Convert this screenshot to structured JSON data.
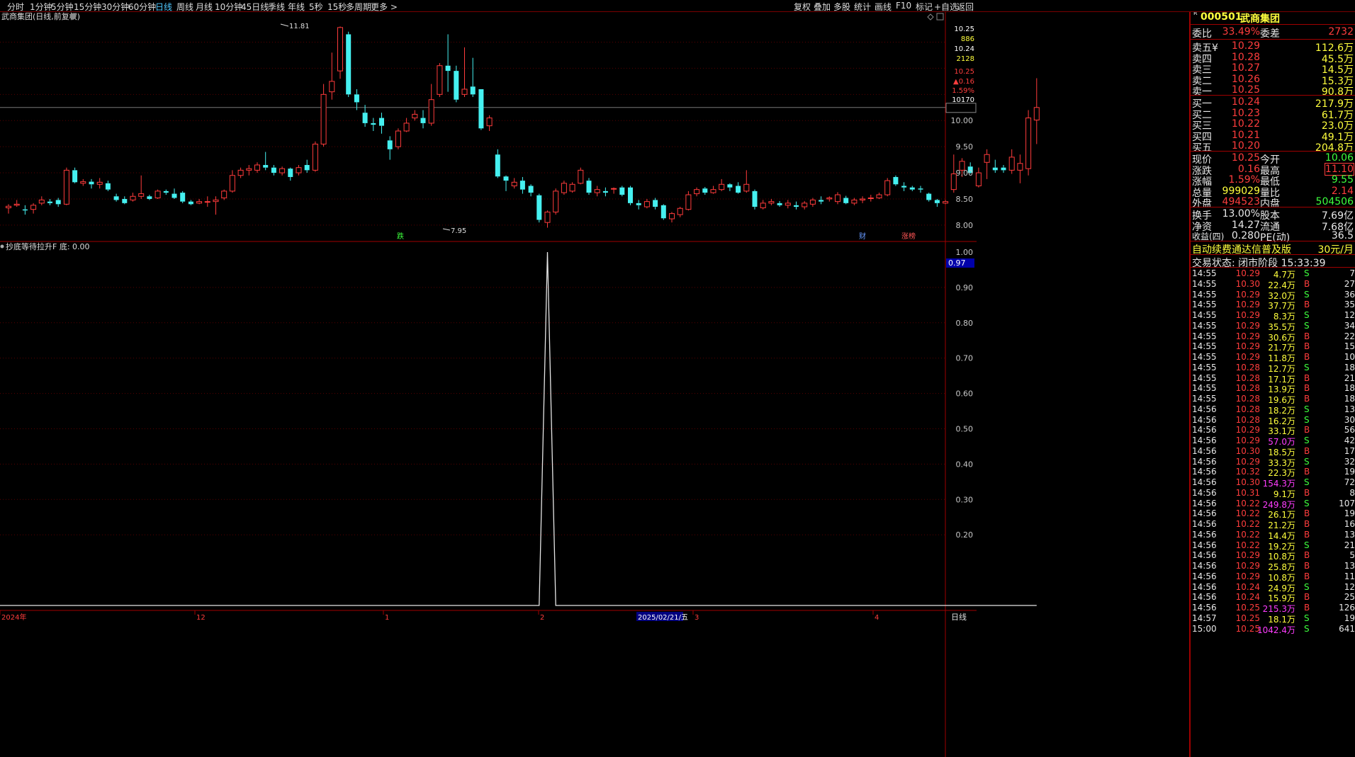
{
  "toolbar": {
    "left": [
      "分时",
      "1分钟",
      "5分钟",
      "15分钟",
      "30分钟",
      "60分钟",
      "日线",
      "周线",
      "月线",
      "10分钟",
      "45日线",
      "季线",
      "年线",
      "5秒",
      "15秒",
      "多周期",
      "更多 >"
    ],
    "active": "日线",
    "right": [
      "复权",
      "叠加",
      "多股",
      "统计",
      "画线",
      "F10",
      "标记",
      "+自选",
      "返回"
    ]
  },
  "chart": {
    "title": "武商集团(日线,前复权)",
    "indicator_title": "抄底等待拉升F 底: 0.00",
    "high_label": "11.81",
    "low_label": "7.95",
    "price_ticks": [
      "10.00",
      "9.50",
      "9.00",
      "8.50",
      "8.00"
    ],
    "osc_ticks": [
      "1.00",
      "0.90",
      "0.80",
      "0.70",
      "0.60",
      "0.50",
      "0.40",
      "0.30",
      "0.20"
    ],
    "osc_current": "0.97",
    "cursor_info": [
      "10.25",
      "886",
      "10.24",
      "2128",
      "10.25",
      "▲0.16",
      "1.59%",
      "10170"
    ],
    "date_labels": [
      "2024年",
      "12",
      "1",
      "2",
      "3",
      "4"
    ],
    "cursor_date": "2025/02/21/五",
    "period_label": "日线",
    "markers": [
      "跌",
      "财",
      "涨榜"
    ]
  },
  "chart_data": {
    "type": "candlestick",
    "candles": [
      [
        8.33,
        8.36,
        8.22,
        8.4
      ],
      [
        8.38,
        8.4,
        8.35,
        8.48
      ],
      [
        8.3,
        8.28,
        8.2,
        8.38
      ],
      [
        8.3,
        8.38,
        8.22,
        8.42
      ],
      [
        8.42,
        8.48,
        8.38,
        8.55
      ],
      [
        8.45,
        8.42,
        8.38,
        8.5
      ],
      [
        8.48,
        8.4,
        8.35,
        8.52
      ],
      [
        8.4,
        9.05,
        8.38,
        9.1
      ],
      [
        9.05,
        8.82,
        8.8,
        9.1
      ],
      [
        8.8,
        8.83,
        8.75,
        8.88
      ],
      [
        8.83,
        8.78,
        8.7,
        8.88
      ],
      [
        8.78,
        8.82,
        8.7,
        8.9
      ],
      [
        8.8,
        8.68,
        8.65,
        8.85
      ],
      [
        8.55,
        8.48,
        8.45,
        8.6
      ],
      [
        8.5,
        8.42,
        8.4,
        8.55
      ],
      [
        8.48,
        8.55,
        8.45,
        8.62
      ],
      [
        8.55,
        8.6,
        8.5,
        8.95
      ],
      [
        8.55,
        8.5,
        8.48,
        8.58
      ],
      [
        8.52,
        8.65,
        8.5,
        8.68
      ],
      [
        8.65,
        8.62,
        8.58,
        8.68
      ],
      [
        8.6,
        8.52,
        8.5,
        8.7
      ],
      [
        8.62,
        8.45,
        8.42,
        8.65
      ],
      [
        8.45,
        8.4,
        8.38,
        8.48
      ],
      [
        8.42,
        8.45,
        8.4,
        8.5
      ],
      [
        8.45,
        8.45,
        8.35,
        8.55
      ],
      [
        8.45,
        8.48,
        8.2,
        8.55
      ],
      [
        8.52,
        8.65,
        8.48,
        8.68
      ],
      [
        8.65,
        8.95,
        8.62,
        9.05
      ],
      [
        8.95,
        9.05,
        8.9,
        9.1
      ],
      [
        9.05,
        9.08,
        8.95,
        9.15
      ],
      [
        9.05,
        9.15,
        9.0,
        9.2
      ],
      [
        9.15,
        9.1,
        9.05,
        9.4
      ],
      [
        9.1,
        9.0,
        8.95,
        9.15
      ],
      [
        9.0,
        9.08,
        8.95,
        9.12
      ],
      [
        9.08,
        8.92,
        8.85,
        9.1
      ],
      [
        9.0,
        9.1,
        8.95,
        9.15
      ],
      [
        9.15,
        9.05,
        9.0,
        9.25
      ],
      [
        9.05,
        9.55,
        9.02,
        9.6
      ],
      [
        9.55,
        10.5,
        9.5,
        10.7
      ],
      [
        10.55,
        10.75,
        10.4,
        11.3
      ],
      [
        10.95,
        11.78,
        10.8,
        11.8
      ],
      [
        11.65,
        10.5,
        10.45,
        11.7
      ],
      [
        10.5,
        10.35,
        10.2,
        10.6
      ],
      [
        10.15,
        9.95,
        9.88,
        10.3
      ],
      [
        9.95,
        9.92,
        9.8,
        10.05
      ],
      [
        10.05,
        9.9,
        9.75,
        10.15
      ],
      [
        9.62,
        9.45,
        9.25,
        9.7
      ],
      [
        9.5,
        9.8,
        9.45,
        9.85
      ],
      [
        9.8,
        9.95,
        9.78,
        10.05
      ],
      [
        10.05,
        10.12,
        10.0,
        10.2
      ],
      [
        10.05,
        9.95,
        9.85,
        10.2
      ],
      [
        9.95,
        10.4,
        9.9,
        10.7
      ],
      [
        10.5,
        11.05,
        10.45,
        11.1
      ],
      [
        11.05,
        10.95,
        10.55,
        11.65
      ],
      [
        10.95,
        10.4,
        10.35,
        11.05
      ],
      [
        10.5,
        10.6,
        10.45,
        11.4
      ],
      [
        10.65,
        10.5,
        10.45,
        11.2
      ],
      [
        10.6,
        9.85,
        9.82,
        10.6
      ],
      [
        9.9,
        10.05,
        9.8,
        10.1
      ],
      [
        9.35,
        8.93,
        8.9,
        9.45
      ],
      [
        8.93,
        8.85,
        8.65,
        8.95
      ],
      [
        8.75,
        8.82,
        8.7,
        8.9
      ],
      [
        8.85,
        8.68,
        8.6,
        8.92
      ],
      [
        8.75,
        8.62,
        8.55,
        8.78
      ],
      [
        8.57,
        8.1,
        8.05,
        8.6
      ],
      [
        8.05,
        8.25,
        7.95,
        8.28
      ],
      [
        8.25,
        8.65,
        8.2,
        8.7
      ],
      [
        8.62,
        8.8,
        8.58,
        8.85
      ],
      [
        8.65,
        8.78,
        8.62,
        8.82
      ],
      [
        8.8,
        9.05,
        8.78,
        9.1
      ],
      [
        8.85,
        8.62,
        8.58,
        8.9
      ],
      [
        8.62,
        8.68,
        8.55,
        8.75
      ],
      [
        8.65,
        8.62,
        8.55,
        8.72
      ],
      [
        8.7,
        8.7,
        8.6,
        8.72
      ],
      [
        8.72,
        8.58,
        8.55,
        8.75
      ],
      [
        8.72,
        8.42,
        8.38,
        8.75
      ],
      [
        8.42,
        8.38,
        8.3,
        8.48
      ],
      [
        8.35,
        8.45,
        8.32,
        8.5
      ],
      [
        8.48,
        8.35,
        8.3,
        8.52
      ],
      [
        8.38,
        8.13,
        8.1,
        8.4
      ],
      [
        8.12,
        8.22,
        8.05,
        8.25
      ],
      [
        8.2,
        8.32,
        8.15,
        8.35
      ],
      [
        8.3,
        8.58,
        8.28,
        8.65
      ],
      [
        8.6,
        8.68,
        8.55,
        8.72
      ],
      [
        8.7,
        8.62,
        8.58,
        8.73
      ],
      [
        8.62,
        8.68,
        8.6,
        8.75
      ],
      [
        8.68,
        8.78,
        8.65,
        8.88
      ],
      [
        8.78,
        8.72,
        8.65,
        8.8
      ],
      [
        8.75,
        8.62,
        8.6,
        8.82
      ],
      [
        8.65,
        8.78,
        8.62,
        9.05
      ],
      [
        8.65,
        8.35,
        8.3,
        8.68
      ],
      [
        8.33,
        8.42,
        8.3,
        8.48
      ],
      [
        8.42,
        8.45,
        8.38,
        8.5
      ],
      [
        8.42,
        8.38,
        8.35,
        8.46
      ],
      [
        8.38,
        8.42,
        8.32,
        8.48
      ],
      [
        8.38,
        8.35,
        8.3,
        8.45
      ],
      [
        8.35,
        8.42,
        8.3,
        8.46
      ],
      [
        8.4,
        8.48,
        8.35,
        8.52
      ],
      [
        8.48,
        8.45,
        8.4,
        8.55
      ],
      [
        8.5,
        8.52,
        8.45,
        8.55
      ],
      [
        8.45,
        8.58,
        8.4,
        8.63
      ],
      [
        8.52,
        8.42,
        8.4,
        8.56
      ],
      [
        8.42,
        8.48,
        8.38,
        8.52
      ],
      [
        8.48,
        8.5,
        8.42,
        8.55
      ],
      [
        8.52,
        8.52,
        8.45,
        8.58
      ],
      [
        8.52,
        8.58,
        8.5,
        8.62
      ],
      [
        8.58,
        8.85,
        8.55,
        8.9
      ],
      [
        8.92,
        8.78,
        8.75,
        8.95
      ],
      [
        8.75,
        8.72,
        8.65,
        8.82
      ],
      [
        8.72,
        8.68,
        8.65,
        8.75
      ],
      [
        8.7,
        8.68,
        8.62,
        8.75
      ],
      [
        8.6,
        8.48,
        8.45,
        8.62
      ],
      [
        8.48,
        8.42,
        8.35,
        8.5
      ],
      [
        8.42,
        8.45,
        8.4,
        8.48
      ],
      [
        8.68,
        8.98,
        8.62,
        9.35
      ],
      [
        9.05,
        9.22,
        8.92,
        9.28
      ],
      [
        9.12,
        9.0,
        8.98,
        9.2
      ],
      [
        8.75,
        9.0,
        8.72,
        9.1
      ],
      [
        9.2,
        9.35,
        8.88,
        9.45
      ],
      [
        9.1,
        9.05,
        9.0,
        9.25
      ],
      [
        9.1,
        9.05,
        9.0,
        9.15
      ],
      [
        9.05,
        9.3,
        8.98,
        9.45
      ],
      [
        9.05,
        9.18,
        8.8,
        9.35
      ],
      [
        9.08,
        10.05,
        8.95,
        10.2
      ],
      [
        10.01,
        10.25,
        9.55,
        10.81
      ]
    ],
    "indicator_peak_index": 65,
    "ylim": [
      7.7,
      11.9
    ],
    "osc_ylim": [
      0,
      1.0
    ]
  },
  "panel": {
    "code": "000501",
    "name": "武商集团",
    "weibi": {
      "label": "委比",
      "value": "33.49%",
      "label2": "委差",
      "value2": "2732"
    },
    "asks": [
      {
        "label": "卖五¥",
        "price": "10.29",
        "vol": "112.6万"
      },
      {
        "label": "卖四",
        "price": "10.28",
        "vol": "45.5万"
      },
      {
        "label": "卖三",
        "price": "10.27",
        "vol": "14.5万"
      },
      {
        "label": "卖二",
        "price": "10.26",
        "vol": "15.3万"
      },
      {
        "label": "卖一",
        "price": "10.25",
        "vol": "90.8万"
      }
    ],
    "bids": [
      {
        "label": "买一",
        "price": "10.24",
        "vol": "217.9万"
      },
      {
        "label": "买二",
        "price": "10.23",
        "vol": "61.7万"
      },
      {
        "label": "买三",
        "price": "10.22",
        "vol": "23.0万"
      },
      {
        "label": "买四",
        "price": "10.21",
        "vol": "49.1万"
      },
      {
        "label": "买五",
        "price": "10.20",
        "vol": "204.8万"
      }
    ],
    "stats": [
      {
        "l1": "现价",
        "v1": "10.25",
        "l2": "今开",
        "v2": "10.06",
        "c2": "green"
      },
      {
        "l1": "涨跌",
        "v1": "0.16",
        "l2": "最高",
        "v2": "11.10",
        "c2": "red",
        "boxed": true
      },
      {
        "l1": "涨幅",
        "v1": "1.59%",
        "l2": "最低",
        "v2": "9.55",
        "c2": "green"
      },
      {
        "l1": "总量",
        "v1": "999029",
        "l2": "量比",
        "v2": "2.14",
        "c2": "red",
        "c1": "yellow"
      },
      {
        "l1": "外盘",
        "v1": "494523",
        "l2": "内盘",
        "v2": "504506",
        "c2": "green"
      }
    ],
    "stats2": [
      {
        "l1": "换手",
        "v1": "13.00%",
        "l2": "股本",
        "v2": "7.69亿"
      },
      {
        "l1": "净资",
        "v1": "14.27",
        "l2": "流通",
        "v2": "7.68亿"
      },
      {
        "l1": "收益(四)",
        "v1": "0.280",
        "l2": "PE(动)",
        "v2": "36.5"
      }
    ],
    "ad": {
      "text": "自动续费通达信普及版",
      "price": "30元/月"
    },
    "status": "交易状态: 闭市阶段 15:33:39",
    "trades": [
      [
        "14:55",
        "10.29",
        "4.7万",
        "S",
        "7"
      ],
      [
        "14:55",
        "10.30",
        "22.4万",
        "B",
        "27"
      ],
      [
        "14:55",
        "10.29",
        "32.0万",
        "S",
        "36"
      ],
      [
        "14:55",
        "10.29",
        "37.7万",
        "B",
        "35"
      ],
      [
        "14:55",
        "10.29",
        "8.3万",
        "S",
        "12"
      ],
      [
        "14:55",
        "10.29",
        "35.5万",
        "S",
        "34"
      ],
      [
        "14:55",
        "10.29",
        "30.6万",
        "B",
        "22"
      ],
      [
        "14:55",
        "10.29",
        "21.7万",
        "B",
        "15"
      ],
      [
        "14:55",
        "10.29",
        "11.8万",
        "B",
        "10"
      ],
      [
        "14:55",
        "10.28",
        "12.7万",
        "S",
        "18"
      ],
      [
        "14:55",
        "10.28",
        "17.1万",
        "B",
        "21"
      ],
      [
        "14:55",
        "10.28",
        "13.9万",
        "B",
        "18"
      ],
      [
        "14:55",
        "10.28",
        "19.6万",
        "B",
        "18"
      ],
      [
        "14:56",
        "10.28",
        "18.2万",
        "S",
        "13"
      ],
      [
        "14:56",
        "10.28",
        "16.2万",
        "S",
        "30"
      ],
      [
        "14:56",
        "10.29",
        "33.1万",
        "B",
        "56"
      ],
      [
        "14:56",
        "10.29",
        "57.0万",
        "S",
        "42"
      ],
      [
        "14:56",
        "10.30",
        "18.5万",
        "B",
        "17"
      ],
      [
        "14:56",
        "10.29",
        "33.3万",
        "S",
        "32"
      ],
      [
        "14:56",
        "10.32",
        "22.3万",
        "B",
        "19"
      ],
      [
        "14:56",
        "10.30",
        "154.3万",
        "S",
        "72"
      ],
      [
        "14:56",
        "10.31",
        "9.1万",
        "B",
        "8"
      ],
      [
        "14:56",
        "10.22",
        "249.8万",
        "S",
        "107"
      ],
      [
        "14:56",
        "10.22",
        "26.1万",
        "B",
        "19"
      ],
      [
        "14:56",
        "10.22",
        "21.2万",
        "B",
        "16"
      ],
      [
        "14:56",
        "10.22",
        "14.4万",
        "B",
        "13"
      ],
      [
        "14:56",
        "10.22",
        "19.2万",
        "S",
        "21"
      ],
      [
        "14:56",
        "10.29",
        "10.8万",
        "B",
        "5"
      ],
      [
        "14:56",
        "10.29",
        "25.8万",
        "B",
        "13"
      ],
      [
        "14:56",
        "10.29",
        "10.8万",
        "B",
        "11"
      ],
      [
        "14:56",
        "10.24",
        "24.9万",
        "S",
        "12"
      ],
      [
        "14:56",
        "10.24",
        "15.9万",
        "B",
        "25"
      ],
      [
        "14:56",
        "10.25",
        "215.3万",
        "B",
        "126"
      ],
      [
        "14:57",
        "10.25",
        "18.1万",
        "S",
        "19"
      ],
      [
        "15:00",
        "10.25",
        "1042.4万",
        "S",
        "641"
      ]
    ]
  }
}
